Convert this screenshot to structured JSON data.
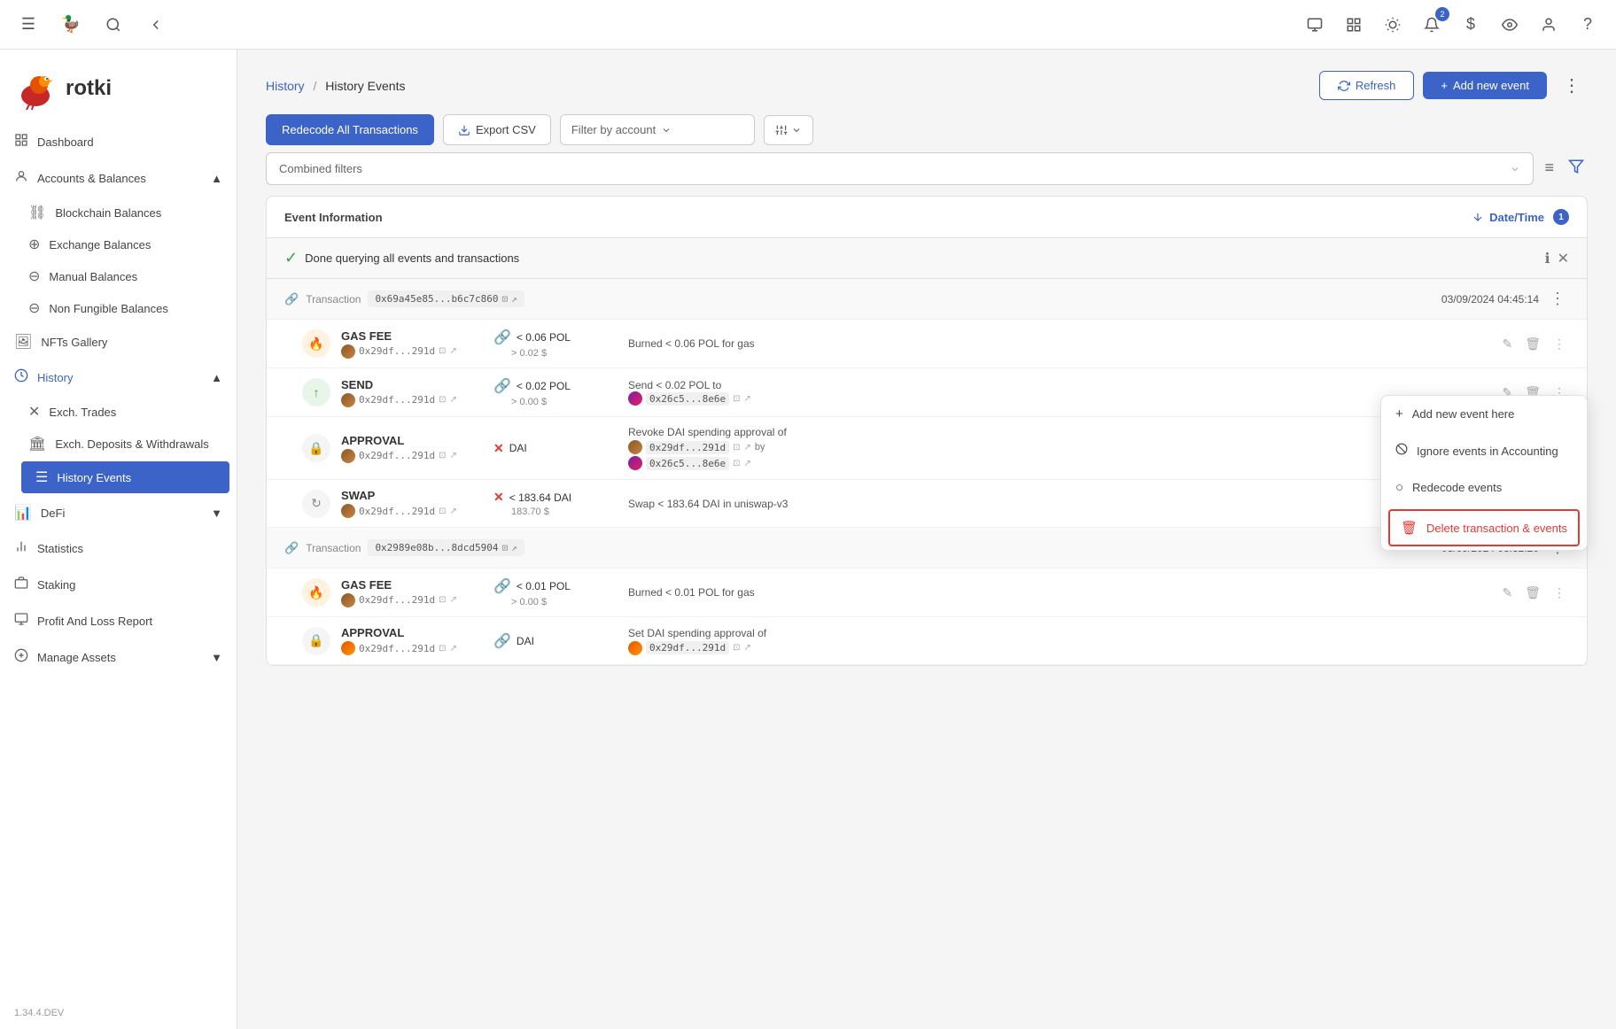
{
  "app": {
    "version": "1.34.4.DEV",
    "logo_text": "rotki"
  },
  "topbar": {
    "icons": [
      "code-icon",
      "layout-icon",
      "sun-icon",
      "bell-icon",
      "dollar-icon",
      "eye-icon",
      "user-icon",
      "help-icon"
    ],
    "bell_badge": "2",
    "red_badge": true
  },
  "sidebar": {
    "nav_groups": [
      {
        "label": "Dashboard",
        "icon": "dashboard-icon",
        "expandable": false
      },
      {
        "label": "Accounts & Balances",
        "icon": "accounts-icon",
        "expandable": true,
        "expanded": true,
        "children": [
          {
            "label": "Blockchain Balances",
            "icon": "blockchain-icon"
          },
          {
            "label": "Exchange Balances",
            "icon": "exchange-icon"
          },
          {
            "label": "Manual Balances",
            "icon": "manual-icon"
          },
          {
            "label": "Non Fungible Balances",
            "icon": "nft-icon"
          }
        ]
      },
      {
        "label": "NFTs Gallery",
        "icon": "gallery-icon",
        "expandable": false
      },
      {
        "label": "History",
        "icon": "history-icon",
        "expandable": true,
        "expanded": true,
        "children": [
          {
            "label": "Exch. Trades",
            "icon": "trades-icon"
          },
          {
            "label": "Exch. Deposits & Withdrawals",
            "icon": "deposits-icon"
          },
          {
            "label": "History Events",
            "icon": "events-icon",
            "active": true
          }
        ]
      },
      {
        "label": "DeFi",
        "icon": "defi-icon",
        "expandable": true,
        "expanded": false
      },
      {
        "label": "Statistics",
        "icon": "stats-icon",
        "expandable": false
      },
      {
        "label": "Staking",
        "icon": "staking-icon",
        "expandable": false
      },
      {
        "label": "Profit And Loss Report",
        "icon": "profit-icon",
        "expandable": false
      },
      {
        "label": "Manage Assets",
        "icon": "assets-icon",
        "expandable": true,
        "expanded": false
      }
    ]
  },
  "header": {
    "breadcrumb_parent": "History",
    "breadcrumb_separator": "/",
    "breadcrumb_current": "History Events",
    "refresh_label": "Refresh",
    "add_label": "Add new event"
  },
  "toolbar": {
    "recode_label": "Redecode All Transactions",
    "export_label": "Export CSV",
    "filter_account_placeholder": "Filter by account",
    "combined_filters_placeholder": "Combined filters"
  },
  "table": {
    "col_event": "Event Information",
    "col_datetime": "Date/Time",
    "sort_badge": "1",
    "status_text": "Done querying all events and transactions",
    "transactions": [
      {
        "id": "tx1",
        "hash_display": "0x69a45e85...b6c7c860",
        "datetime": "03/09/2024 04:45:14",
        "events": [
          {
            "type": "GAS FEE",
            "addr": "0x29df...291d",
            "token_icon": "pol-icon",
            "amount_label": "< 0.06 POL",
            "usd_label": "> 0.02 $",
            "description": "Burned < 0.06 POL for gas",
            "event_icon": "flame-icon"
          },
          {
            "type": "SEND",
            "addr": "0x29df...291d",
            "token_icon": "pol-icon",
            "amount_label": "< 0.02 POL",
            "usd_label": "> 0.00 $",
            "description": "Send < 0.02 POL to",
            "to_addr": "0x26c5...8e6e",
            "event_icon": "arrow-up-icon"
          },
          {
            "type": "APPROVAL",
            "addr": "0x29df...291d",
            "token_icon": "x-icon",
            "amount_label": "DAI",
            "usd_label": "",
            "description": "Revoke DAI spending approval of",
            "by_addr": "0x29df...291d",
            "by_addr2": "0x26c5...8e6e",
            "event_icon": "lock-icon"
          },
          {
            "type": "SWAP",
            "addr": "0x29df...291d",
            "token_icon": "x-icon",
            "amount_label": "< 183.64 DAI",
            "usd_label": "183.70 $",
            "description": "Swap < 183.64 DAI in uniswap-v3",
            "event_icon": "swap-icon"
          }
        ]
      },
      {
        "id": "tx2",
        "hash_display": "0x2989e08b...8dcd5904",
        "datetime": "03/09/2024 03:32:20",
        "events": [
          {
            "type": "GAS FEE",
            "addr": "0x29df...291d",
            "token_icon": "pol-icon",
            "amount_label": "< 0.01 POL",
            "usd_label": "> 0.00 $",
            "description": "Burned < 0.01 POL for gas",
            "event_icon": "flame-icon"
          },
          {
            "type": "APPROVAL",
            "addr": "0x29df...291d",
            "token_icon": "dai-icon",
            "amount_label": "DAI",
            "usd_label": "",
            "description": "Set DAI spending approval of",
            "by_addr": "0x29df...291d",
            "event_icon": "lock-icon"
          }
        ]
      }
    ],
    "context_menu": {
      "add_label": "Add new event here",
      "ignore_label": "Ignore events in Accounting",
      "recode_label": "Redecode events",
      "delete_label": "Delete transaction & events"
    }
  }
}
